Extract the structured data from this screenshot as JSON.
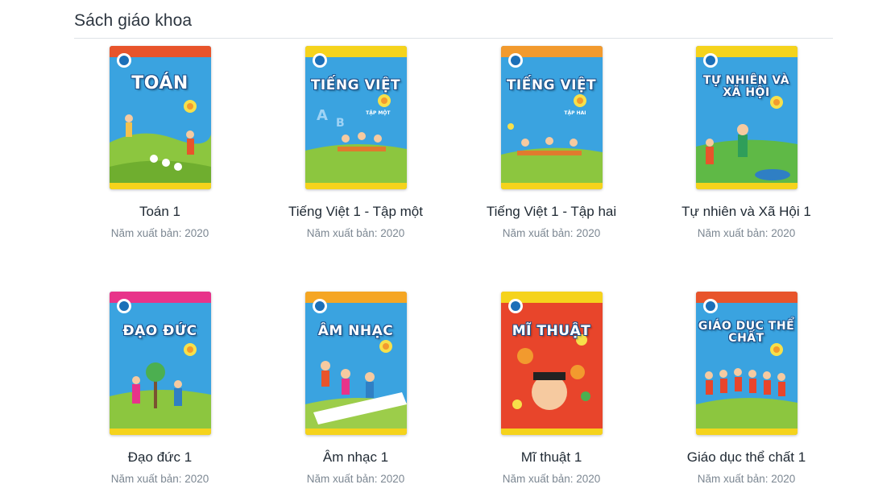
{
  "section": {
    "title": "Sách giáo khoa"
  },
  "books": [
    {
      "name": "Toán 1",
      "year": "Năm xuất bản: 2020",
      "cover_title": "TOÁN",
      "cover_subtitle": "",
      "colors": {
        "band": "#e8542b",
        "sky": "#3aa3e0",
        "ground": "#8cc63f"
      }
    },
    {
      "name": "Tiếng Việt 1 - Tập một",
      "year": "Năm xuất bản: 2020",
      "cover_title": "TIẾNG VIỆT",
      "cover_subtitle": "TẬP MỘT",
      "colors": {
        "band": "#f5d31c",
        "sky": "#3aa3e0",
        "ground": "#8cc63f"
      }
    },
    {
      "name": "Tiếng Việt 1 - Tập hai",
      "year": "Năm xuất bản: 2020",
      "cover_title": "TIẾNG VIỆT",
      "cover_subtitle": "TẬP HAI",
      "colors": {
        "band": "#f29a2e",
        "sky": "#3aa3e0",
        "ground": "#8cc63f"
      }
    },
    {
      "name": "Tự nhiên và Xã Hội 1",
      "year": "Năm xuất bản: 2020",
      "cover_title": "TỰ NHIÊN VÀ XÃ HỘI",
      "cover_subtitle": "",
      "colors": {
        "band": "#f5d31c",
        "sky": "#3aa3e0",
        "ground": "#5fb946"
      }
    },
    {
      "name": "Đạo đức 1",
      "year": "Năm xuất bản: 2020",
      "cover_title": "ĐẠO ĐỨC",
      "cover_subtitle": "",
      "colors": {
        "band": "#e8338a",
        "sky": "#3aa3e0",
        "ground": "#8cc63f"
      }
    },
    {
      "name": "Âm nhạc 1",
      "year": "Năm xuất bản: 2020",
      "cover_title": "ÂM NHẠC",
      "cover_subtitle": "",
      "colors": {
        "band": "#f5a623",
        "sky": "#3aa3e0",
        "ground": "#9ccd4a"
      }
    },
    {
      "name": "Mĩ thuật 1",
      "year": "Năm xuất bản: 2020",
      "cover_title": "MĨ THUẬT",
      "cover_subtitle": "",
      "colors": {
        "band": "#f5d31c",
        "sky": "#e8452b",
        "ground": "#e8452b"
      }
    },
    {
      "name": "Giáo dục thể chất 1",
      "year": "Năm xuất bản: 2020",
      "cover_title": "GIÁO DỤC THỂ CHẤT",
      "cover_subtitle": "",
      "colors": {
        "band": "#e8542b",
        "sky": "#3aa3e0",
        "ground": "#8cc63f"
      }
    }
  ]
}
